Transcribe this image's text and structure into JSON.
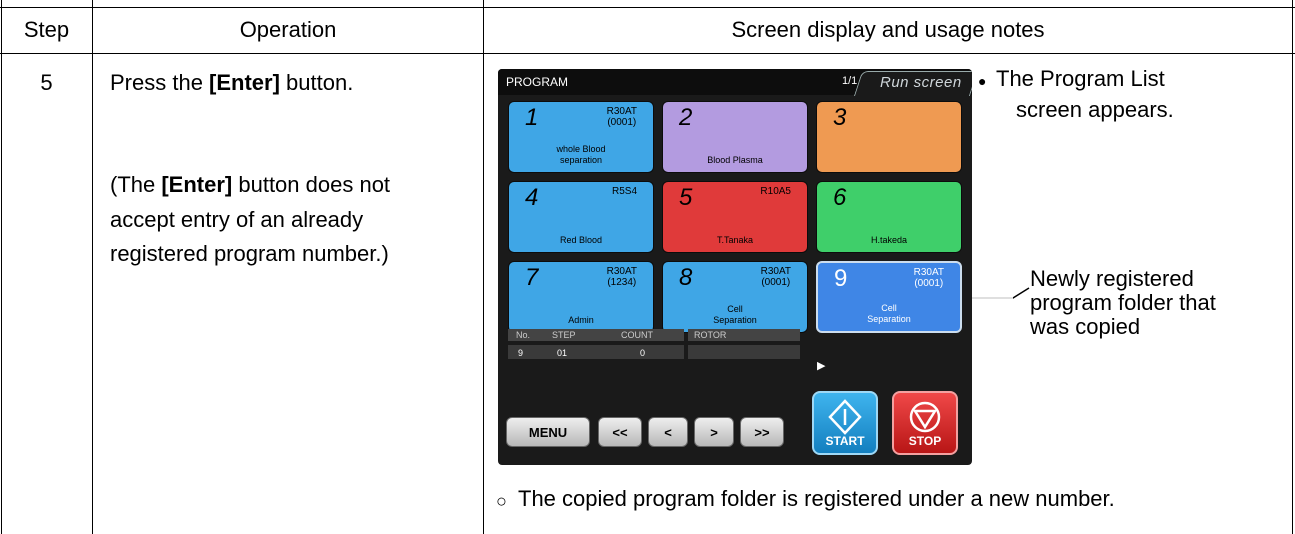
{
  "headers": {
    "step": "Step",
    "operation": "Operation",
    "notes": "Screen display and usage notes"
  },
  "row": {
    "step": "5",
    "op_line1_pre": "Press the ",
    "op_line1_bold": "[Enter]",
    "op_line1_post": " button.",
    "op_p2_pre": "(The ",
    "op_p2_bold": "[Enter]",
    "op_p2_l1_post": " button does not",
    "op_p2_l2": "accept entry of an already",
    "op_p2_l3": "registered program number.)",
    "note_bullet_l1": "The Program List",
    "note_bullet_l2": "screen appears.",
    "callout_l1": "Newly registered",
    "callout_l2": "program folder that",
    "callout_l3": "was copied",
    "footer_note": "The copied program folder is registered under a new number."
  },
  "screen": {
    "title": "PROGRAM",
    "page": "1/1",
    "run_tab": "Run screen",
    "tiles": [
      {
        "num": "1",
        "rotor1": "R30AT",
        "rotor2": "(0001)",
        "name1": "whole Blood",
        "name2": "separation",
        "color": "#3fa6e6"
      },
      {
        "num": "2",
        "rotor1": "",
        "rotor2": "",
        "name1": "Blood Plasma",
        "name2": "",
        "color": "#b39be0"
      },
      {
        "num": "3",
        "rotor1": "",
        "rotor2": "",
        "name1": "",
        "name2": "",
        "color": "#ef9a52"
      },
      {
        "num": "4",
        "rotor1": "R5S4",
        "rotor2": "",
        "name1": "Red Blood",
        "name2": "",
        "color": "#3fa6e6"
      },
      {
        "num": "5",
        "rotor1": "R10A5",
        "rotor2": "",
        "name1": "T.Tanaka",
        "name2": "",
        "color": "#e03a3a"
      },
      {
        "num": "6",
        "rotor1": "",
        "rotor2": "",
        "name1": "H.takeda",
        "name2": "",
        "color": "#3fcf6a"
      },
      {
        "num": "7",
        "rotor1": "R30AT",
        "rotor2": "(1234)",
        "name1": "Admin",
        "name2": "",
        "color": "#3fa6e6"
      },
      {
        "num": "8",
        "rotor1": "R30AT",
        "rotor2": "(0001)",
        "name1": "Cell",
        "name2": "Separation",
        "color": "#3fa6e6"
      },
      {
        "num": "9",
        "rotor1": "R30AT",
        "rotor2": "(0001)",
        "name1": "Cell",
        "name2": "Separation",
        "color": "#3f86e6"
      }
    ],
    "info": {
      "no_label": "No.",
      "step_label": "STEP",
      "count_label": "COUNT",
      "rotor_label": "ROTOR",
      "no_val": "9",
      "step_val": "01",
      "count_val": "0",
      "rotor_val": ""
    },
    "nav": {
      "menu": "MENU",
      "first": "<<",
      "prev": "<",
      "next": ">",
      "last": ">>"
    },
    "start": "START",
    "stop": "STOP"
  }
}
